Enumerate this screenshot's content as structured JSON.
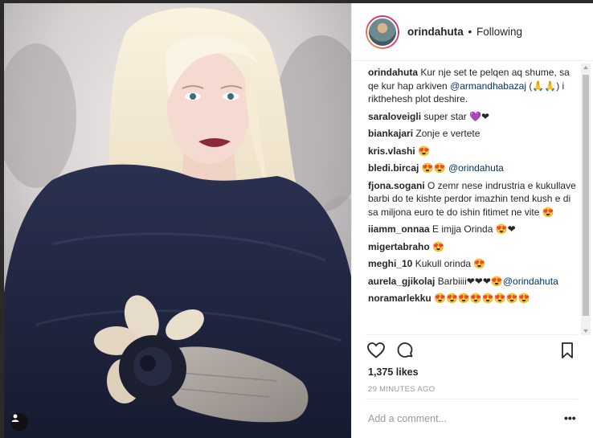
{
  "header": {
    "username": "orindahuta",
    "separator": "•",
    "follow_status": "Following"
  },
  "caption": {
    "user": "orindahuta",
    "text_before": "Kur nje set te pelqen aq shume, sa qe kur hap arkiven",
    "mention": "@armandhabazaj",
    "text_after": "(🙏🙏) i rikthehesh plot deshire."
  },
  "comments": [
    {
      "user": "saraloveigli",
      "text": "super star 💜❤"
    },
    {
      "user": "biankajari",
      "text": "Zonje e vertete"
    },
    {
      "user": "kris.vlashi",
      "text": "😍"
    },
    {
      "user": "bledi.bircaj",
      "text": "😍😍",
      "mention": "@orindahuta"
    },
    {
      "user": "fjona.sogani",
      "text": "O zemr nese indrustria e kukullave barbi do te kishte perdor imazhin tend kush e di sa miljona euro te do ishin fitimet ne vite 😍"
    },
    {
      "user": "iiamm_onnaa",
      "text": "E imjja Orinda 😍❤"
    },
    {
      "user": "migertabraho",
      "text": "😍"
    },
    {
      "user": "meghi_10",
      "text": "Kukull orinda 😍"
    },
    {
      "user": "aurela_gjikolaj",
      "text": "Barbiiii❤❤❤😍",
      "mention": "@orindahuta"
    },
    {
      "user": "noramarlekku",
      "text": "😍😍😍😍😍😍😍😍"
    }
  ],
  "actions": {
    "like_icon": "heart-icon",
    "comment_icon": "comment-bubble-icon",
    "save_icon": "bookmark-icon"
  },
  "likes": "1,375 likes",
  "timestamp": "29 MINUTES AGO",
  "add_comment": {
    "placeholder": "Add a comment..."
  },
  "more_options": "•••",
  "colors": {
    "mention": "#003569",
    "text": "#262626",
    "muted": "#999999",
    "coat": "#1e2440",
    "lips": "#8a2a3c"
  }
}
